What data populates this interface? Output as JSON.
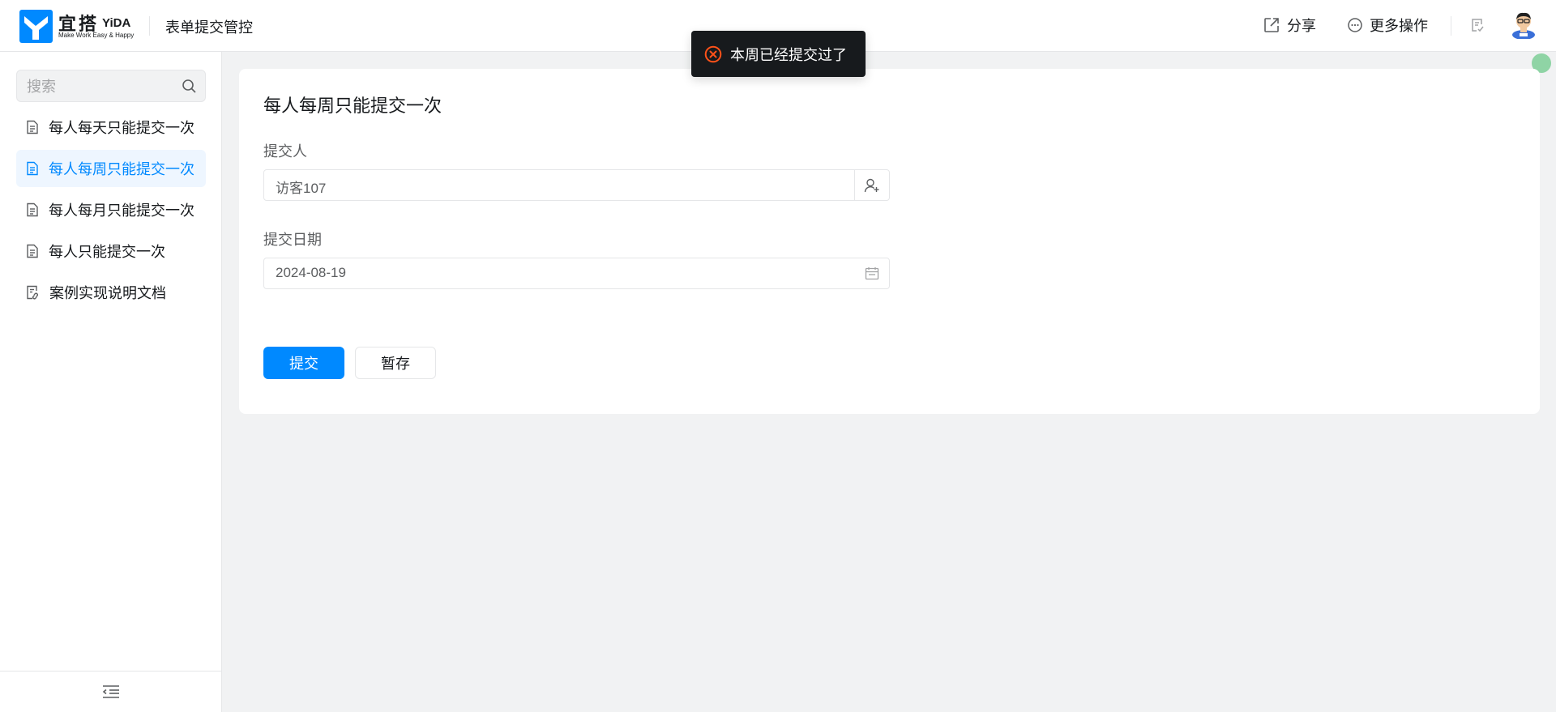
{
  "header": {
    "logo_cn": "宜搭",
    "logo_en": "YiDA",
    "logo_slogan": "Make Work Easy & Happy",
    "app_title": "表单提交管控",
    "share_label": "分享",
    "more_label": "更多操作"
  },
  "toast": {
    "message": "本周已经提交过了",
    "type": "error",
    "icon": "error-circle-icon"
  },
  "sidebar": {
    "search_placeholder": "搜索",
    "items": [
      {
        "label": "每人每天只能提交一次",
        "icon": "document-icon",
        "active": false
      },
      {
        "label": "每人每周只能提交一次",
        "icon": "document-icon",
        "active": true
      },
      {
        "label": "每人每月只能提交一次",
        "icon": "document-icon",
        "active": false
      },
      {
        "label": "每人只能提交一次",
        "icon": "document-icon",
        "active": false
      },
      {
        "label": "案例实现说明文档",
        "icon": "doc-link-icon",
        "active": false
      }
    ]
  },
  "form": {
    "title": "每人每周只能提交一次",
    "submitter_label": "提交人",
    "submitter_value": "访客107",
    "date_label": "提交日期",
    "date_value": "2024-08-19",
    "submit_label": "提交",
    "save_draft_label": "暂存"
  },
  "colors": {
    "accent": "#0089ff",
    "error": "#ff5219",
    "toast_bg": "#171a1d",
    "active_bg": "#eef6ff"
  }
}
